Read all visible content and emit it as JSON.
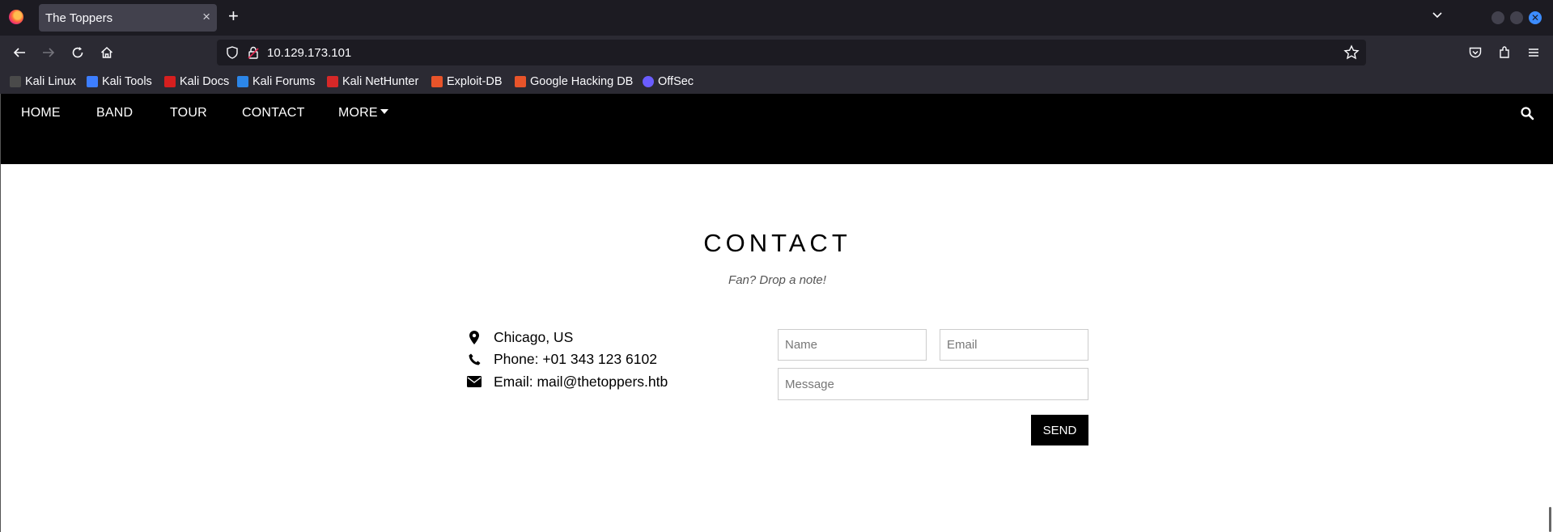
{
  "browser": {
    "tab_title": "The Toppers",
    "tab_close": "×",
    "new_tab": "+",
    "url": "10.129.173.101"
  },
  "bookmarks": [
    {
      "label": "Kali Linux",
      "color": "#4a4a4a"
    },
    {
      "label": "Kali Tools",
      "color": "#3d7eff"
    },
    {
      "label": "Kali Docs",
      "color": "#d61f1f"
    },
    {
      "label": "Kali Forums",
      "color": "#2c86e8"
    },
    {
      "label": "Kali NetHunter",
      "color": "#d62828"
    },
    {
      "label": "Exploit-DB",
      "color": "#e8542a"
    },
    {
      "label": "Google Hacking DB",
      "color": "#e8542a"
    },
    {
      "label": "OffSec",
      "color": "#6a5cff"
    }
  ],
  "site_nav": {
    "items": [
      "HOME",
      "BAND",
      "TOUR",
      "CONTACT",
      "MORE"
    ]
  },
  "contact": {
    "title": "CONTACT",
    "subtitle": "Fan? Drop a note!",
    "location": "Chicago, US",
    "phone": "Phone: +01 343 123 6102",
    "email": "Email: mail@thetoppers.htb"
  },
  "form": {
    "name_placeholder": "Name",
    "email_placeholder": "Email",
    "message_placeholder": "Message",
    "send_label": "SEND"
  }
}
